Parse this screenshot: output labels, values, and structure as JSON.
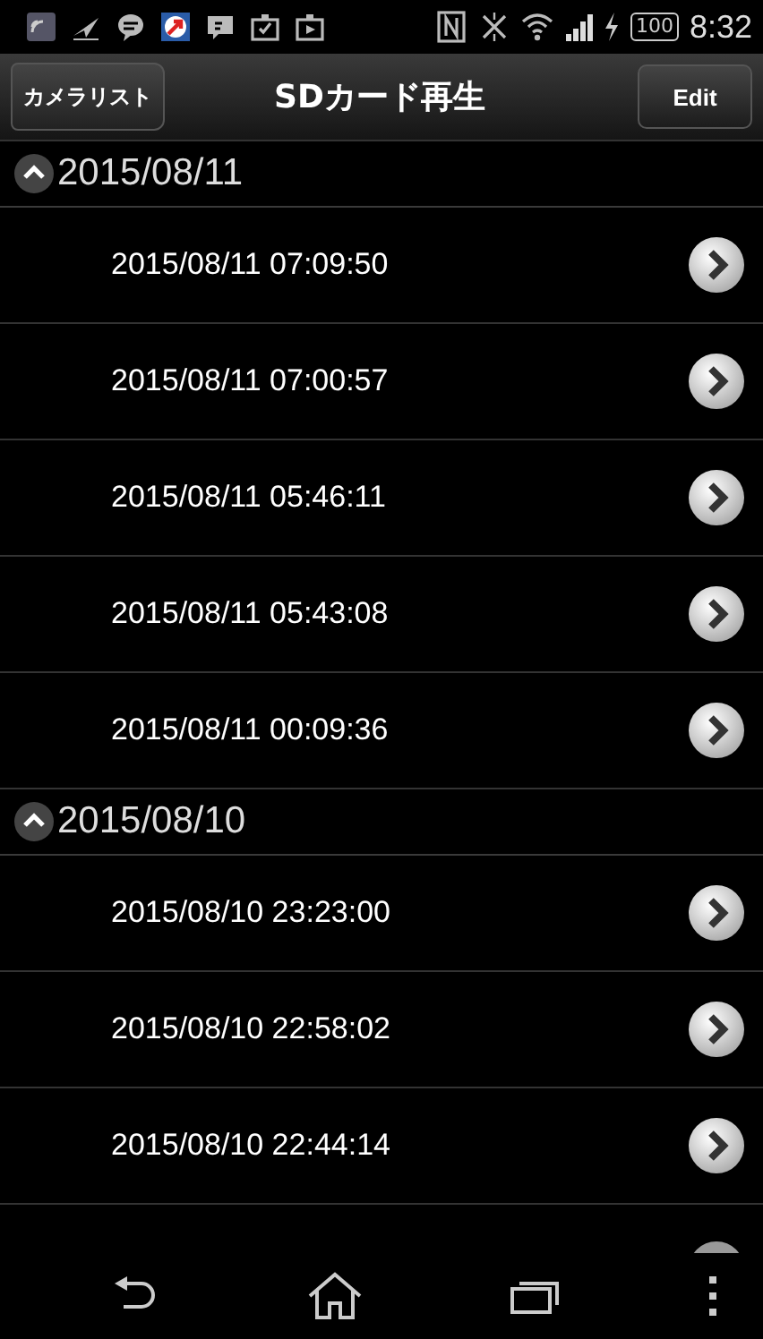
{
  "status_bar": {
    "battery": "100",
    "time": "8:32"
  },
  "nav_bar": {
    "back_button": "カメラリスト",
    "title": "SDカード再生",
    "edit_button": "Edit"
  },
  "sections": [
    {
      "date": "2015/08/11",
      "expanded": true,
      "items": [
        "2015/08/11 07:09:50",
        "2015/08/11 07:00:57",
        "2015/08/11 05:46:11",
        "2015/08/11 05:43:08",
        "2015/08/11 00:09:36"
      ]
    },
    {
      "date": "2015/08/10",
      "expanded": true,
      "items": [
        "2015/08/10 23:23:00",
        "2015/08/10 22:58:02",
        "2015/08/10 22:44:14"
      ]
    }
  ]
}
